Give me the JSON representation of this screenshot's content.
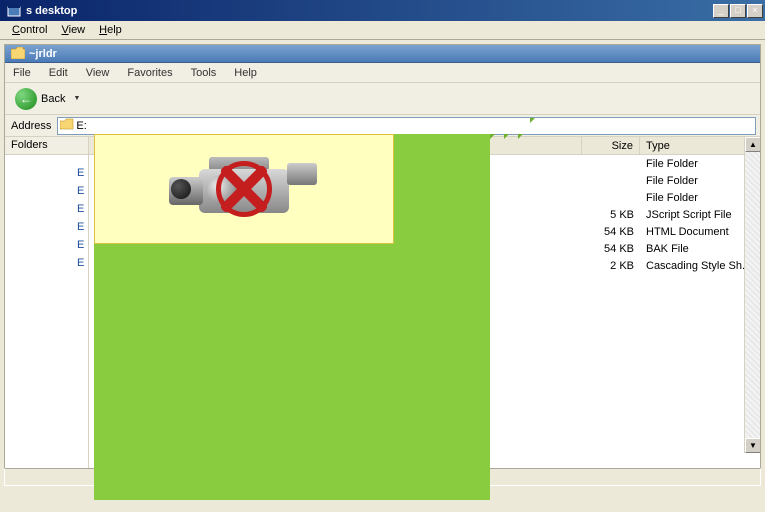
{
  "window": {
    "title": "s desktop"
  },
  "outer_menu": {
    "control": "Control",
    "view": "View",
    "help": "Help"
  },
  "inner": {
    "title": "~jrldr",
    "menu": {
      "file": "File",
      "edit": "Edit",
      "view": "View",
      "favorites": "Favorites",
      "tools": "Tools",
      "help": "Help"
    },
    "toolbar": {
      "back": "Back"
    },
    "address": {
      "label": "Address",
      "value": "E:"
    },
    "folders_pane": {
      "header": "Folders"
    },
    "columns": {
      "name": "",
      "size": "Size",
      "type": "Type"
    },
    "rows": [
      {
        "size": "",
        "type": "File Folder"
      },
      {
        "size": "",
        "type": "File Folder"
      },
      {
        "size": "",
        "type": "File Folder"
      },
      {
        "size": "5 KB",
        "type": "JScript Script File"
      },
      {
        "size": "54 KB",
        "type": "HTML Document"
      },
      {
        "size": "54 KB",
        "type": "BAK File"
      },
      {
        "size": "2 KB",
        "type": "Cascading Style Sh..."
      }
    ]
  },
  "overlay": {
    "semantic": "camcorder-blocked"
  }
}
